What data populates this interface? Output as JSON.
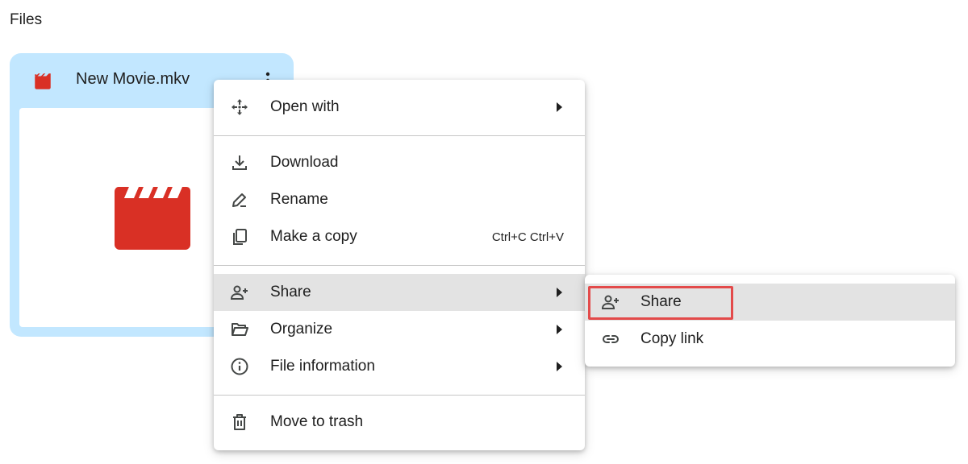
{
  "section": {
    "title": "Files"
  },
  "file_card": {
    "name": "New Movie.mkv",
    "type_icon": "movie-clapperboard-icon",
    "more_icon": "more-vert-icon"
  },
  "context_menu": {
    "items": [
      {
        "label": "Open with",
        "icon": "open-with-icon",
        "shortcut": "",
        "has_submenu": true
      },
      {
        "label": "Download",
        "icon": "download-icon",
        "shortcut": "",
        "has_submenu": false
      },
      {
        "label": "Rename",
        "icon": "rename-pencil-icon",
        "shortcut": "",
        "has_submenu": false
      },
      {
        "label": "Make a copy",
        "icon": "copy-icon",
        "shortcut": "Ctrl+C Ctrl+V",
        "has_submenu": false
      },
      {
        "label": "Share",
        "icon": "person-add-icon",
        "shortcut": "",
        "has_submenu": true
      },
      {
        "label": "Organize",
        "icon": "folder-open-icon",
        "shortcut": "",
        "has_submenu": true
      },
      {
        "label": "File information",
        "icon": "info-icon",
        "shortcut": "",
        "has_submenu": true
      },
      {
        "label": "Move to trash",
        "icon": "trash-icon",
        "shortcut": "",
        "has_submenu": false
      }
    ]
  },
  "share_submenu": {
    "items": [
      {
        "label": "Share",
        "icon": "person-add-icon"
      },
      {
        "label": "Copy link",
        "icon": "link-icon"
      }
    ]
  },
  "colors": {
    "card_background": "#c2e7ff",
    "movie_red": "#d93025",
    "hover_background": "#e3e3e3",
    "highlight_red": "#e34a4a",
    "text": "#1f1f1f"
  }
}
